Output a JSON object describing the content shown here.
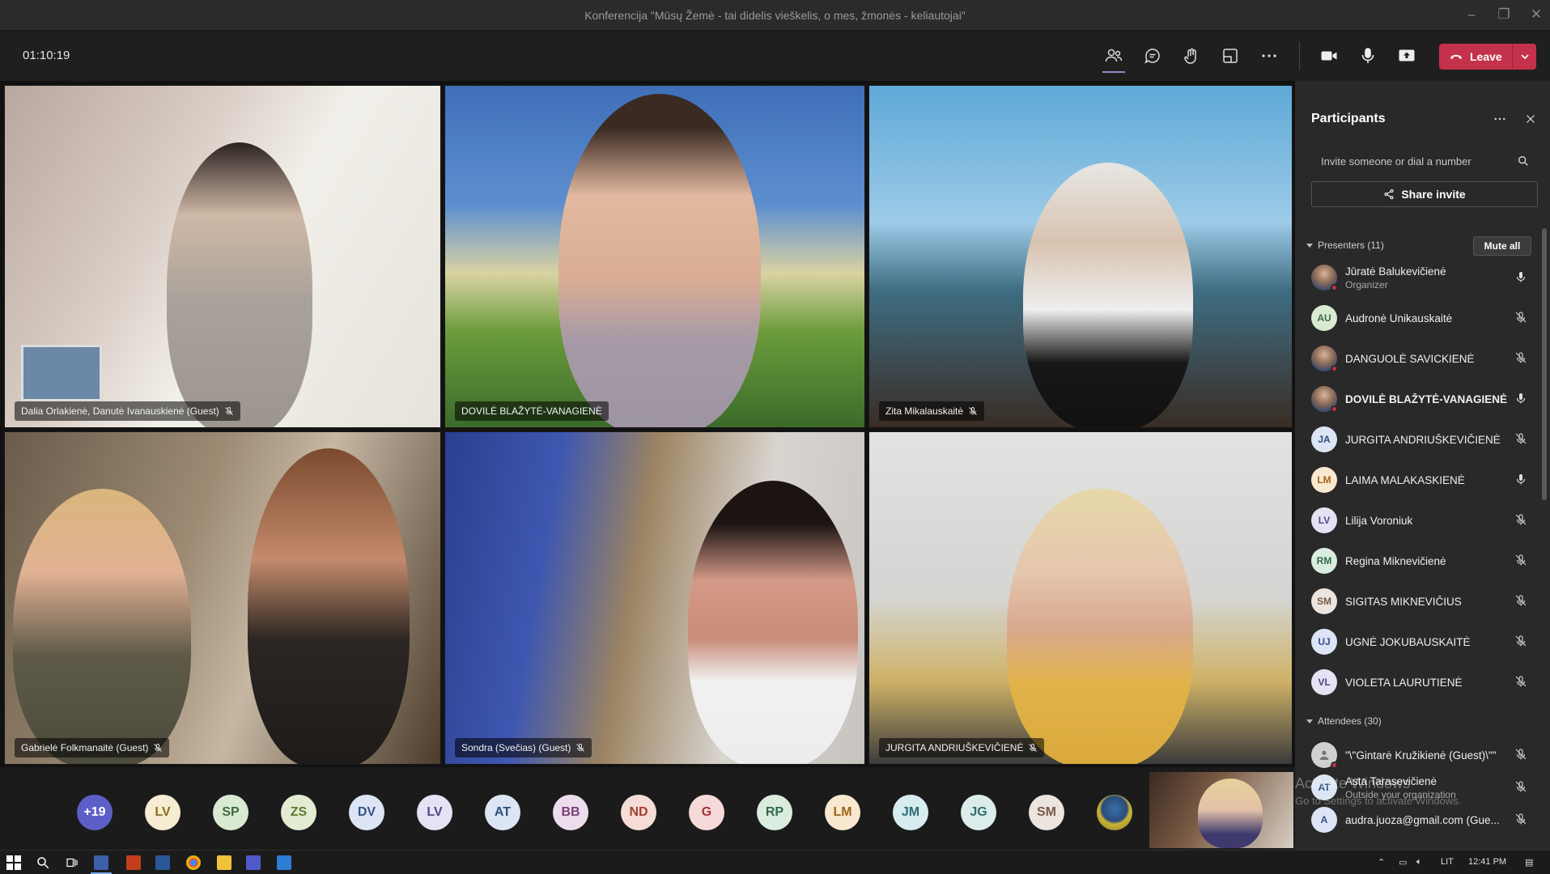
{
  "window": {
    "title": "Konferencija \"Mūsų Žemė - tai didelis vieškelis, o mes, žmonės - keliautojai\""
  },
  "toolbar": {
    "timer": "01:10:19",
    "leave_label": "Leave"
  },
  "tiles": [
    {
      "name": "Dalia Orlakienė, Danutė Ivanauskienė (Guest)",
      "muted": true
    },
    {
      "name": "DOVILĖ BLAŽYTĖ-VANAGIENĖ",
      "muted": false
    },
    {
      "name": "Zita Mikalauskaitė",
      "muted": true
    },
    {
      "name": "Gabrielė Folkmanaitė (Guest)",
      "muted": true
    },
    {
      "name": "Sondra (Svečias) (Guest)",
      "muted": true
    },
    {
      "name": "JURGITA ANDRIUŠKEVIČIENĖ",
      "muted": true
    }
  ],
  "strip": {
    "overflow": "+19",
    "avatars": [
      "LV",
      "SP",
      "ZS",
      "DV",
      "LV",
      "AT",
      "BB",
      "ND",
      "G",
      "RP",
      "LM",
      "JM",
      "JG",
      "SM"
    ]
  },
  "panel": {
    "title": "Participants",
    "invite_placeholder": "Invite someone or dial a number",
    "share_label": "Share invite",
    "presenters_label": "Presenters (11)",
    "mute_all_label": "Mute all",
    "attendees_label": "Attendees (30)",
    "presenters": [
      {
        "initials": "",
        "name": "Jūratė Balukevičienė",
        "role": "Organizer",
        "mic": "on",
        "photo": true
      },
      {
        "initials": "AU",
        "name": "Audronė Unikauskaitė",
        "role": "",
        "mic": "off",
        "photo": false
      },
      {
        "initials": "",
        "name": "DANGUOLĖ SAVICKIENĖ",
        "role": "",
        "mic": "off",
        "photo": true
      },
      {
        "initials": "",
        "name": "DOVILĖ BLAŽYTĖ-VANAGIENĖ",
        "role": "",
        "mic": "on",
        "photo": true
      },
      {
        "initials": "JA",
        "name": "JURGITA ANDRIUŠKEVIČIENĖ",
        "role": "",
        "mic": "off",
        "photo": false
      },
      {
        "initials": "LM",
        "name": "LAIMA MALAKASKIENĖ",
        "role": "",
        "mic": "on",
        "photo": false
      },
      {
        "initials": "LV",
        "name": "Lilija Voroniuk",
        "role": "",
        "mic": "off",
        "photo": false
      },
      {
        "initials": "RM",
        "name": "Regina Miknevičienė",
        "role": "",
        "mic": "off",
        "photo": false
      },
      {
        "initials": "SM",
        "name": "SIGITAS MIKNEVIČIUS",
        "role": "",
        "mic": "off",
        "photo": false
      },
      {
        "initials": "UJ",
        "name": "UGNĖ JOKUBAUSKAITĖ",
        "role": "",
        "mic": "off",
        "photo": false
      },
      {
        "initials": "VL",
        "name": "VIOLETA LAURUTIENĖ",
        "role": "",
        "mic": "off",
        "photo": false
      }
    ],
    "attendees": [
      {
        "initials": "",
        "name": "\"\\\"Gintarė Kružikienė (Guest)\\\"\"",
        "mic": "off"
      },
      {
        "initials": "AT",
        "name": "Asta Tarasevičienė",
        "sub": "Outside your organization",
        "mic": "off"
      },
      {
        "initials": "A",
        "name": "audra.juoza@gmail.com (Gue...",
        "mic": "off"
      }
    ]
  },
  "watermark": {
    "line1": "Activate Windows",
    "line2": "Go to Settings to activate Windows."
  },
  "taskbar": {
    "lang": "LIT",
    "time": "12:41 PM"
  },
  "colors": {
    "leave": "#c4314b",
    "accent": "#6264a7",
    "panel_bg": "#292929"
  }
}
